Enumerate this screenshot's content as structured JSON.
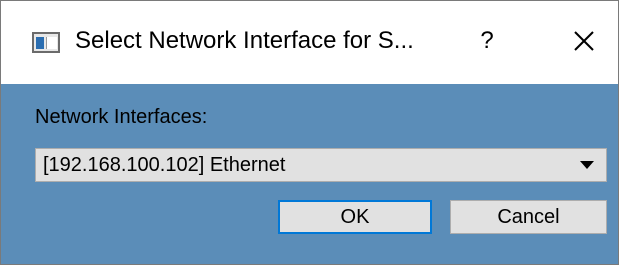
{
  "window": {
    "title": "Select Network Interface for S...",
    "help_label": "?",
    "icons": {
      "app": "window-app-icon",
      "close": "close-icon"
    }
  },
  "form": {
    "interfaces_label": "Network Interfaces:",
    "selected_interface": "[192.168.100.102] Ethernet",
    "dropdown_icon": "chevron-down-icon"
  },
  "buttons": {
    "ok_label": "OK",
    "cancel_label": "Cancel"
  },
  "colors": {
    "client_background": "#5b8db8",
    "focus_border": "#0078d7",
    "button_face": "#e1e1e1"
  }
}
